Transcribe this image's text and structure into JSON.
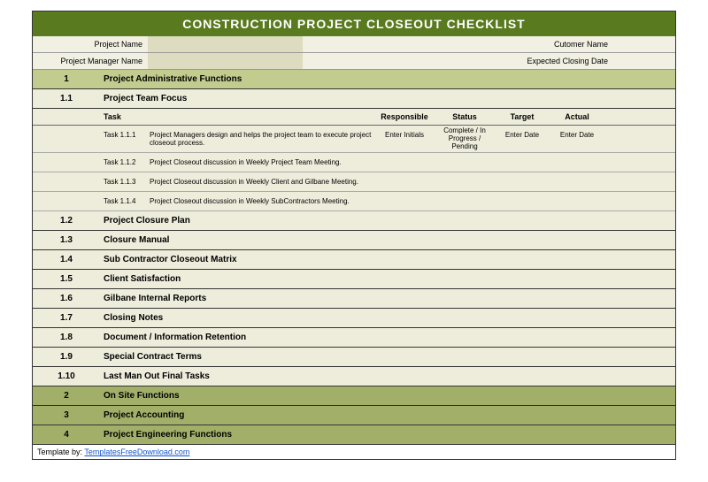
{
  "title": "CONSTRUCTION PROJECT CLOSEOUT CHECKLIST",
  "info": {
    "project_name_label": "Project Name",
    "project_manager_label": "Project Manager Name",
    "customer_name_label": "Cutomer Name",
    "closing_date_label": "Expected Closing Date"
  },
  "cols": {
    "task": "Task",
    "responsible": "Responsible",
    "status": "Status",
    "target": "Target",
    "actual": "Actual"
  },
  "sec1": {
    "num": "1",
    "title": "Project Administrative Functions"
  },
  "sub11": {
    "num": "1.1",
    "title": "Project Team Focus"
  },
  "tasks": [
    {
      "id": "Task 1.1.1",
      "desc": "Project Managers design and helps the project team to execute project closeout process.",
      "resp": "Enter Initials",
      "stat": "Complete / In Progress / Pending",
      "targ": "Enter Date",
      "act": "Enter Date"
    },
    {
      "id": "Task 1.1.2",
      "desc": "Project Closeout discussion in Weekly Project Team Meeting.",
      "resp": "",
      "stat": "",
      "targ": "",
      "act": ""
    },
    {
      "id": "Task 1.1.3",
      "desc": "Project Closeout discussion in Weekly Client and Gilbane Meeting.",
      "resp": "",
      "stat": "",
      "targ": "",
      "act": ""
    },
    {
      "id": "Task 1.1.4",
      "desc": "Project Closeout discussion in Weekly SubContractors Meeting.",
      "resp": "",
      "stat": "",
      "targ": "",
      "act": ""
    }
  ],
  "subs": [
    {
      "num": "1.2",
      "title": "Project Closure Plan"
    },
    {
      "num": "1.3",
      "title": "Closure Manual"
    },
    {
      "num": "1.4",
      "title": "Sub Contractor Closeout Matrix"
    },
    {
      "num": "1.5",
      "title": "Client Satisfaction"
    },
    {
      "num": "1.6",
      "title": "Gilbane Internal Reports"
    },
    {
      "num": "1.7",
      "title": "Closing Notes"
    },
    {
      "num": "1.8",
      "title": "Document / Information Retention"
    },
    {
      "num": "1.9",
      "title": "Special Contract Terms"
    },
    {
      "num": "1.10",
      "title": "Last Man Out Final Tasks"
    }
  ],
  "majors": [
    {
      "num": "2",
      "title": "On Site Functions"
    },
    {
      "num": "3",
      "title": "Project Accounting"
    },
    {
      "num": "4",
      "title": "Project Engineering Functions"
    }
  ],
  "footer": {
    "prefix": "Template by: ",
    "link": "TemplatesFreeDownload.com"
  }
}
